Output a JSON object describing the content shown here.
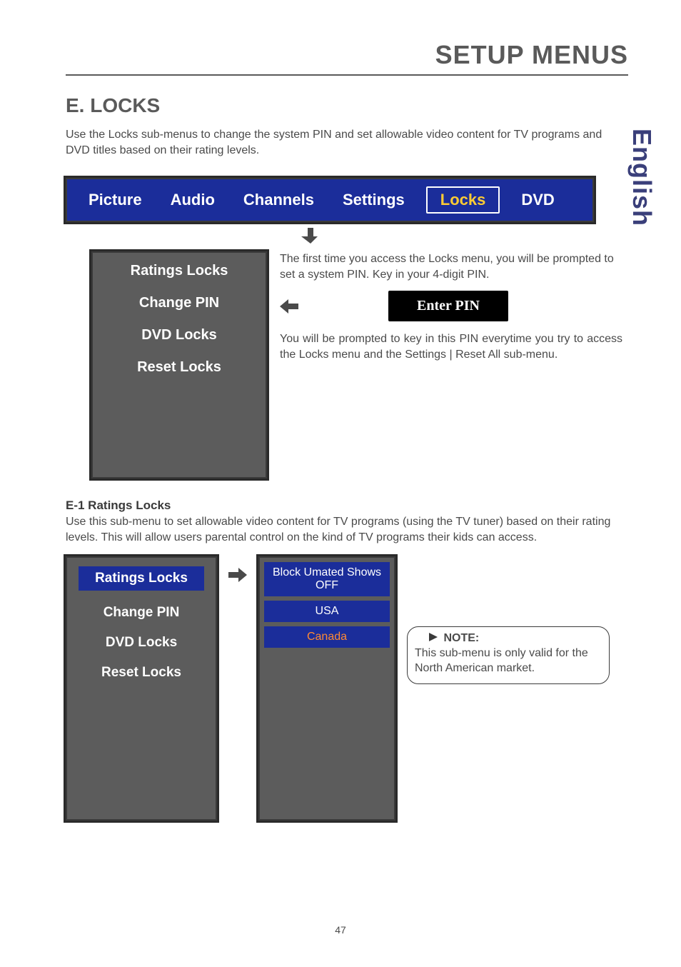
{
  "page": {
    "section_title": "SETUP MENUS",
    "heading": "E. LOCKS",
    "intro": "Use the Locks sub-menus to change the system PIN and set allowable video content for TV programs and DVD titles based on their rating levels.",
    "language": "English",
    "page_number": "47"
  },
  "tabs": {
    "picture": "Picture",
    "audio": "Audio",
    "channels": "Channels",
    "settings": "Settings",
    "locks": "Locks",
    "dvd": "DVD"
  },
  "locks_submenu": {
    "ratings_locks": "Ratings Locks",
    "change_pin": "Change PIN",
    "dvd_locks": "DVD Locks",
    "reset_locks": "Reset Locks"
  },
  "locks_text": {
    "para1": "The first time you access the Locks menu, you will be prompted to set a system PIN. Key in your 4-digit PIN.",
    "enter_pin": "Enter PIN",
    "para2": "You will be prompted to key in this PIN everytime you try to access the Locks menu and the Settings | Reset All sub-menu."
  },
  "e1": {
    "title": "E-1  Ratings Locks",
    "desc": "Use this sub-menu to set allowable video content for TV programs (using the TV tuner) based on their rating levels. This will allow users parental control on the kind of TV programs their kids can access."
  },
  "ratings_panel": {
    "block_line1": "Block Umated Shows",
    "block_line2": "OFF",
    "usa": "USA",
    "canada": "Canada"
  },
  "note": {
    "label": "NOTE:",
    "text": "This sub-menu is only valid for the North American market."
  }
}
